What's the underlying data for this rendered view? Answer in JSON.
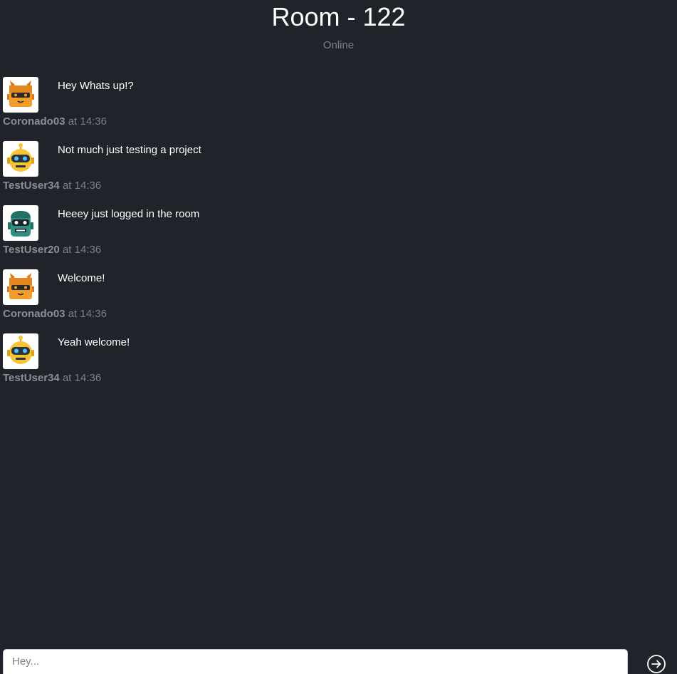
{
  "room": {
    "title": "Room - 122",
    "status": "Online"
  },
  "messages": [
    {
      "user": "Coronado03",
      "at_prefix": "at",
      "time": "14:36",
      "text": "Hey Whats up!?",
      "avatar": "orange-robot-avatar"
    },
    {
      "user": "TestUser34",
      "at_prefix": "at",
      "time": "14:36",
      "text": "Not much just testing a project",
      "avatar": "yellow-robot-avatar"
    },
    {
      "user": "TestUser20",
      "at_prefix": "at",
      "time": "14:36",
      "text": "Heeey just logged in the room",
      "avatar": "teal-robot-avatar"
    },
    {
      "user": "Coronado03",
      "at_prefix": "at",
      "time": "14:36",
      "text": "Welcome!",
      "avatar": "orange-robot-avatar"
    },
    {
      "user": "TestUser34",
      "at_prefix": "at",
      "time": "14:36",
      "text": "Yeah welcome!",
      "avatar": "yellow-robot-avatar"
    }
  ],
  "composer": {
    "placeholder": "Hey...",
    "value": "",
    "send_icon": "arrow-right-circle-icon"
  },
  "colors": {
    "background": "#202329",
    "text": "#ffffff",
    "muted": "#7b8088",
    "orange_robot": "#f39c2c",
    "yellow_robot": "#f7c531",
    "teal_robot": "#2f8f83"
  }
}
